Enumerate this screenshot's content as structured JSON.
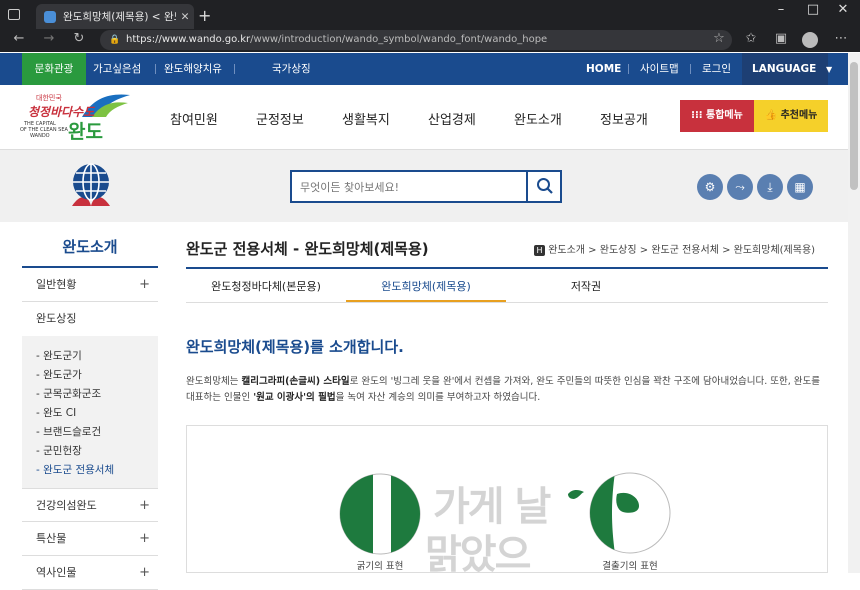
{
  "browser": {
    "tab_title": "완도희망체(제목용) < 완도군 전",
    "url_host": "https://www.wando.go.kr",
    "url_path": "/www/introduction/wando_symbol/wando_font/wando_hope",
    "colors": {
      "frame": "#202124",
      "tab": "#35363a"
    }
  },
  "topbar": {
    "left_items": [
      "문화관광",
      "가고싶은섬",
      "완도해양치유",
      "국가상징"
    ],
    "right_items": [
      "HOME",
      "사이트맵",
      "로그인"
    ],
    "language": "LANGUAGE",
    "colors": {
      "bar": "#1a4b8e",
      "active": "#2a9a3e",
      "language": "#1d3f74"
    }
  },
  "header": {
    "logo": {
      "slogan": "청정바다수도",
      "small": "대한민국",
      "name": "완도",
      "en_line1": "THE CAPITAL",
      "en_line2": "OF THE CLEAN SEA",
      "en_line3": "WANDO"
    },
    "menu": [
      "참여민원",
      "군정정보",
      "생활복지",
      "산업경제",
      "완도소개",
      "정보공개"
    ],
    "btn_total": "통합메뉴",
    "btn_recommend": "추천메뉴",
    "colors": {
      "total": "#c8313d",
      "recommend": "#f5d02a"
    }
  },
  "search": {
    "placeholder": "무엇이든 찾아보세요!"
  },
  "band_icons": [
    "gear-icon",
    "share-icon",
    "download-icon",
    "qr-icon"
  ],
  "sidebar": {
    "title": "완도소개",
    "items": [
      {
        "label": "일반현황",
        "plus": "+"
      },
      {
        "label": "완도상징",
        "plus": ""
      },
      {
        "label": "건강의섬완도",
        "plus": "+"
      },
      {
        "label": "특산물",
        "plus": "+"
      },
      {
        "label": "역사인물",
        "plus": "+"
      }
    ],
    "sub": [
      "완도군기",
      "완도군가",
      "군목군화군조",
      "완도 CI",
      "브랜드슬로건",
      "군민헌장",
      "완도군 전용서체"
    ]
  },
  "main": {
    "title": "완도군 전용서체 - 완도희망체(제목용)",
    "breadcrumb": [
      "완도소개",
      "완도상징",
      "완도군 전용서체",
      "완도희망체(제목용)"
    ],
    "tabs": [
      "완도청정바다체(본문용)",
      "완도희망체(제목용)",
      "저작권"
    ],
    "heading": "완도희망체(제목용)를 소개합니다.",
    "para": {
      "p1": "완도희망체는 ",
      "b1": "캘리그라피(손글씨) 스타일",
      "p2": "로 완도의 '빙그레 웃을 완'에서 컨셉을 가져와, 완도 주민들의 따뜻한 인심을 꽉찬 구조에 담아내었습니다. 또한, 완도를 대표하는 인물인 ",
      "b2": "'원교 이광사'의 필법",
      "p3": "을 녹여 자산 계승의 의미를 부여하고자 하였습니다."
    },
    "specimen": {
      "left_caption": "굵기의 표현",
      "right_caption": "결출기의 표현",
      "sample_line1": "가게 날",
      "sample_line2": "맑았으"
    },
    "colors": {
      "green": "#1e7a3e",
      "accent": "#1a4b8e",
      "tab_active": "#e8a020"
    }
  }
}
